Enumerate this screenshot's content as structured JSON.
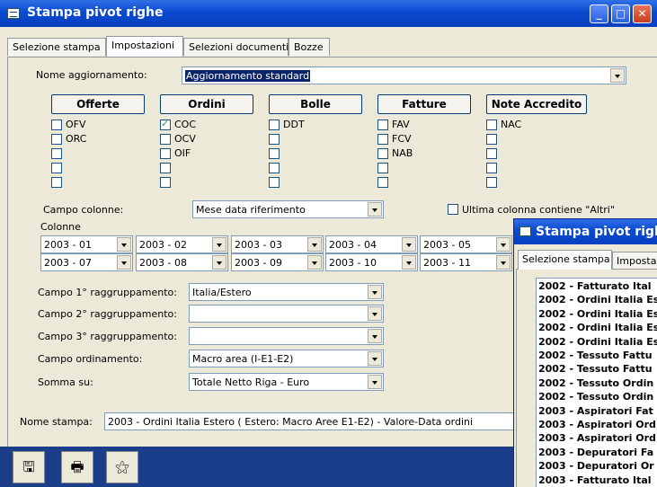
{
  "window": {
    "title": "Stampa pivot righe"
  },
  "tabs": [
    "Selezione stampa",
    "Impostazioni",
    "Selezioni documenti",
    "Bozze"
  ],
  "nome_aggiornamento": {
    "label": "Nome aggiornamento:",
    "value": "Aggiornamento standard"
  },
  "groups": [
    {
      "header": "Offerte",
      "items": [
        {
          "label": "OFV",
          "checked": false
        },
        {
          "label": "ORC",
          "checked": false
        },
        {
          "label": "",
          "checked": false
        },
        {
          "label": "",
          "checked": false
        },
        {
          "label": "",
          "checked": false
        }
      ]
    },
    {
      "header": "Ordini",
      "items": [
        {
          "label": "COC",
          "checked": true
        },
        {
          "label": "OCV",
          "checked": false
        },
        {
          "label": "OIF",
          "checked": false
        },
        {
          "label": "",
          "checked": false
        },
        {
          "label": "",
          "checked": false
        }
      ]
    },
    {
      "header": "Bolle",
      "items": [
        {
          "label": "DDT",
          "checked": false
        },
        {
          "label": "",
          "checked": false
        },
        {
          "label": "",
          "checked": false
        },
        {
          "label": "",
          "checked": false
        },
        {
          "label": "",
          "checked": false
        }
      ]
    },
    {
      "header": "Fatture",
      "items": [
        {
          "label": "FAV",
          "checked": false
        },
        {
          "label": "FCV",
          "checked": false
        },
        {
          "label": "NAB",
          "checked": false
        },
        {
          "label": "",
          "checked": false
        },
        {
          "label": "",
          "checked": false
        }
      ]
    },
    {
      "header": "Note Accredito",
      "items": [
        {
          "label": "NAC",
          "checked": false
        },
        {
          "label": "",
          "checked": false
        },
        {
          "label": "",
          "checked": false
        },
        {
          "label": "",
          "checked": false
        },
        {
          "label": "",
          "checked": false
        }
      ]
    }
  ],
  "campo_colonne": {
    "label": "Campo colonne:",
    "value": "Mese data riferimento"
  },
  "ultima_colonna": {
    "label": "Ultima colonna contiene \"Altri\"",
    "checked": false
  },
  "colonne": {
    "label": "Colonne",
    "row1": [
      "2003 - 01",
      "2003 - 02",
      "2003 - 03",
      "2003 - 04",
      "2003 - 05"
    ],
    "row2": [
      "2003 - 07",
      "2003 - 08",
      "2003 - 09",
      "2003 - 10",
      "2003 - 11"
    ]
  },
  "fields": [
    {
      "label": "Campo 1° raggruppamento:",
      "value": "Italia/Estero"
    },
    {
      "label": "Campo 2° raggruppamento:",
      "value": ""
    },
    {
      "label": "Campo 3° raggruppamento:",
      "value": ""
    },
    {
      "label": "Campo ordinamento:",
      "value": "Macro area (I-E1-E2)"
    },
    {
      "label": "Somma su:",
      "value": "Totale Netto Riga - Euro"
    }
  ],
  "nome_stampa": {
    "label": "Nome stampa:",
    "value": "2003 - Ordini Italia Estero ( Estero: Macro Aree  E1-E2) - Valore-Data ordini"
  },
  "toolbar": {
    "icons": [
      "save-icon",
      "print-icon",
      "wand-icon"
    ],
    "symbols": [
      "🖫",
      "🖶",
      "⚝"
    ]
  },
  "second_window": {
    "title": "Stampa pivot righe",
    "tabs": [
      "Selezione stampa",
      "Impostaz"
    ],
    "list": [
      "2002 - Fatturato Ital",
      "2002 - Ordini Italia Es",
      "2002 - Ordini Italia Es",
      "2002 - Ordini Italia Es",
      "2002 - Ordini Italia Es",
      "2002 - Tessuto  Fattu",
      "2002 - Tessuto  Fattu",
      "2002 - Tessuto Ordin",
      "2002 - Tessuto Ordin",
      "2003 - Aspiratori Fat",
      "2003 - Aspiratori Ord",
      "2003 - Aspiratori Ord",
      "2003 - Depuratori  Fa",
      "2003 - Depuratori Or",
      "2003 - Fatturato Ital"
    ]
  }
}
